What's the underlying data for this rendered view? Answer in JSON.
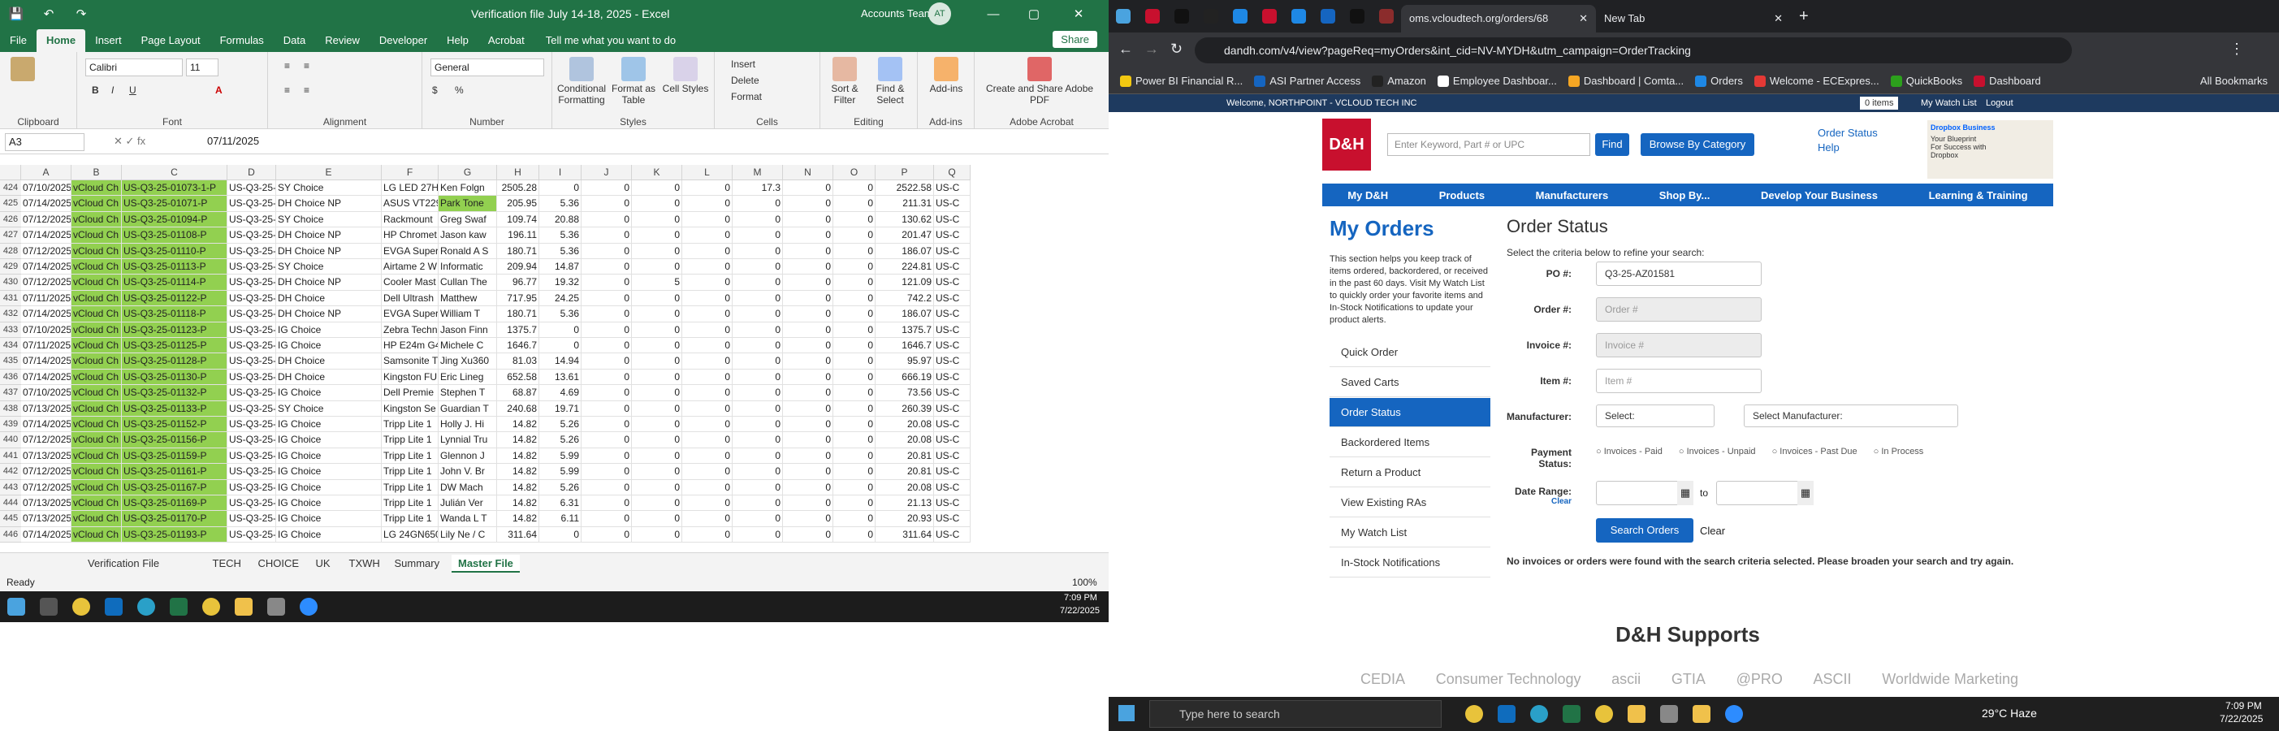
{
  "excel": {
    "title": "Verification file July 14-18, 2025 - Excel",
    "user": "Accounts Team",
    "avatar": "AT",
    "tabs": [
      "File",
      "Home",
      "Insert",
      "Page Layout",
      "Formulas",
      "Data",
      "Review",
      "Developer",
      "Help",
      "Acrobat"
    ],
    "tell": "Tell me what you want to do",
    "share": "Share",
    "font": "Calibri",
    "font_size": "11",
    "number_format": "General",
    "groups": [
      "Clipboard",
      "Font",
      "Alignment",
      "Number",
      "Styles",
      "Cells",
      "Editing",
      "Add-ins",
      "Adobe Acrobat"
    ],
    "buttons": {
      "conditional": "Conditional Formatting",
      "format_table": "Format as Table",
      "cell_styles": "Cell Styles",
      "insert": "Insert",
      "delete": "Delete",
      "format": "Format",
      "sort": "Sort & Filter",
      "find": "Find & Select",
      "addins": "Add-ins",
      "pdf": "Create and Share Adobe PDF"
    },
    "name_box": "A3",
    "formula_value": "07/11/2025",
    "columns": [
      "A",
      "B",
      "C",
      "D",
      "E",
      "F",
      "G",
      "H",
      "I",
      "J",
      "K",
      "L",
      "M",
      "N",
      "O",
      "P",
      "Q"
    ],
    "rows": [
      [
        "424",
        "07/10/2025",
        "vCloud Ch",
        "US-Q3-25-01073-1-P",
        "US-Q3-25-",
        "SY Choice",
        "LG LED 27HJ",
        "Ken Folgn",
        "2505.28",
        "0",
        "0",
        "0",
        "0",
        "17.3",
        "0",
        "0",
        "2522.58",
        "US-C"
      ],
      [
        "425",
        "07/14/2025",
        "vCloud Ch",
        "US-Q3-25-01071-P",
        "US-Q3-25-",
        "DH Choice NP",
        "ASUS VT229",
        "Park Tone",
        "205.95",
        "5.36",
        "0",
        "0",
        "0",
        "0",
        "0",
        "0",
        "211.31",
        "US-C"
      ],
      [
        "426",
        "07/12/2025",
        "vCloud Ch",
        "US-Q3-25-01094-P",
        "US-Q3-25-",
        "SY Choice",
        "Rackmount",
        "Greg Swaf",
        "109.74",
        "20.88",
        "0",
        "0",
        "0",
        "0",
        "0",
        "0",
        "130.62",
        "US-C"
      ],
      [
        "427",
        "07/14/2025",
        "vCloud Ch",
        "US-Q3-25-01108-P",
        "US-Q3-25-",
        "DH Choice NP",
        "HP Chromet",
        "Jason kaw",
        "196.11",
        "5.36",
        "0",
        "0",
        "0",
        "0",
        "0",
        "0",
        "201.47",
        "US-C"
      ],
      [
        "428",
        "07/12/2025",
        "vCloud Ch",
        "US-Q3-25-01110-P",
        "US-Q3-25-",
        "DH Choice NP",
        "EVGA Super",
        "Ronald A S",
        "180.71",
        "5.36",
        "0",
        "0",
        "0",
        "0",
        "0",
        "0",
        "186.07",
        "US-C"
      ],
      [
        "429",
        "07/14/2025",
        "vCloud Ch",
        "US-Q3-25-01113-P",
        "US-Q3-25-",
        "SY Choice",
        "Airtame 2 W",
        "Informatic",
        "209.94",
        "14.87",
        "0",
        "0",
        "0",
        "0",
        "0",
        "0",
        "224.81",
        "US-C"
      ],
      [
        "430",
        "07/12/2025",
        "vCloud Ch",
        "US-Q3-25-01114-P",
        "US-Q3-25-",
        "DH Choice NP",
        "Cooler Mast",
        "Cullan The",
        "96.77",
        "19.32",
        "0",
        "5",
        "0",
        "0",
        "0",
        "0",
        "121.09",
        "US-C"
      ],
      [
        "431",
        "07/11/2025",
        "vCloud Ch",
        "US-Q3-25-01122-P",
        "US-Q3-25-",
        "DH Choice",
        "Dell Ultrash",
        "Matthew",
        "717.95",
        "24.25",
        "0",
        "0",
        "0",
        "0",
        "0",
        "0",
        "742.2",
        "US-C"
      ],
      [
        "432",
        "07/14/2025",
        "vCloud Ch",
        "US-Q3-25-01118-P",
        "US-Q3-25-",
        "DH Choice NP",
        "EVGA Super",
        "William T",
        "180.71",
        "5.36",
        "0",
        "0",
        "0",
        "0",
        "0",
        "0",
        "186.07",
        "US-C"
      ],
      [
        "433",
        "07/10/2025",
        "vCloud Ch",
        "US-Q3-25-01123-P",
        "US-Q3-25-",
        "IG Choice",
        "Zebra Techn",
        "Jason Finn",
        "1375.7",
        "0",
        "0",
        "0",
        "0",
        "0",
        "0",
        "0",
        "1375.7",
        "US-C"
      ],
      [
        "434",
        "07/11/2025",
        "vCloud Ch",
        "US-Q3-25-01125-P",
        "US-Q3-25-",
        "IG Choice",
        "HP E24m G4",
        "Michele C",
        "1646.7",
        "0",
        "0",
        "0",
        "0",
        "0",
        "0",
        "0",
        "1646.7",
        "US-C"
      ],
      [
        "435",
        "07/14/2025",
        "vCloud Ch",
        "US-Q3-25-01128-P",
        "US-Q3-25-",
        "DH Choice",
        "Samsonite T",
        "Jing Xu360",
        "81.03",
        "14.94",
        "0",
        "0",
        "0",
        "0",
        "0",
        "0",
        "95.97",
        "US-C"
      ],
      [
        "436",
        "07/14/2025",
        "vCloud Ch",
        "US-Q3-25-01130-P",
        "US-Q3-25-",
        "DH Choice",
        "Kingston FU",
        "Eric Lineg",
        "652.58",
        "13.61",
        "0",
        "0",
        "0",
        "0",
        "0",
        "0",
        "666.19",
        "US-C"
      ],
      [
        "437",
        "07/10/2025",
        "vCloud Ch",
        "US-Q3-25-01132-P",
        "US-Q3-25-",
        "IG Choice",
        "Dell Premie",
        "Stephen T",
        "68.87",
        "4.69",
        "0",
        "0",
        "0",
        "0",
        "0",
        "0",
        "73.56",
        "US-C"
      ],
      [
        "438",
        "07/13/2025",
        "vCloud Ch",
        "US-Q3-25-01133-P",
        "US-Q3-25-",
        "SY Choice",
        "Kingston Se",
        "Guardian T",
        "240.68",
        "19.71",
        "0",
        "0",
        "0",
        "0",
        "0",
        "0",
        "260.39",
        "US-C"
      ],
      [
        "439",
        "07/14/2025",
        "vCloud Ch",
        "US-Q3-25-01152-P",
        "US-Q3-25-",
        "IG Choice",
        "Tripp Lite 1",
        "Holly J. Hi",
        "14.82",
        "5.26",
        "0",
        "0",
        "0",
        "0",
        "0",
        "0",
        "20.08",
        "US-C"
      ],
      [
        "440",
        "07/12/2025",
        "vCloud Ch",
        "US-Q3-25-01156-P",
        "US-Q3-25-",
        "IG Choice",
        "Tripp Lite 1",
        "Lynnial Tru",
        "14.82",
        "5.26",
        "0",
        "0",
        "0",
        "0",
        "0",
        "0",
        "20.08",
        "US-C"
      ],
      [
        "441",
        "07/13/2025",
        "vCloud Ch",
        "US-Q3-25-01159-P",
        "US-Q3-25-",
        "IG Choice",
        "Tripp Lite 1",
        "Glennon J",
        "14.82",
        "5.99",
        "0",
        "0",
        "0",
        "0",
        "0",
        "0",
        "20.81",
        "US-C"
      ],
      [
        "442",
        "07/12/2025",
        "vCloud Ch",
        "US-Q3-25-01161-P",
        "US-Q3-25-",
        "IG Choice",
        "Tripp Lite 1",
        "John V. Br",
        "14.82",
        "5.99",
        "0",
        "0",
        "0",
        "0",
        "0",
        "0",
        "20.81",
        "US-C"
      ],
      [
        "443",
        "07/12/2025",
        "vCloud Ch",
        "US-Q3-25-01167-P",
        "US-Q3-25-",
        "IG Choice",
        "Tripp Lite 1",
        "DW Mach",
        "14.82",
        "5.26",
        "0",
        "0",
        "0",
        "0",
        "0",
        "0",
        "20.08",
        "US-C"
      ],
      [
        "444",
        "07/13/2025",
        "vCloud Ch",
        "US-Q3-25-01169-P",
        "US-Q3-25-",
        "IG Choice",
        "Tripp Lite 1",
        "Julián Ver",
        "14.82",
        "6.31",
        "0",
        "0",
        "0",
        "0",
        "0",
        "0",
        "21.13",
        "US-C"
      ],
      [
        "445",
        "07/13/2025",
        "vCloud Ch",
        "US-Q3-25-01170-P",
        "US-Q3-25-",
        "IG Choice",
        "Tripp Lite 1",
        "Wanda L T",
        "14.82",
        "6.11",
        "0",
        "0",
        "0",
        "0",
        "0",
        "0",
        "20.93",
        "US-C"
      ],
      [
        "446",
        "07/14/2025",
        "vCloud Ch",
        "US-Q3-25-01193-P",
        "US-Q3-25-",
        "IG Choice",
        "LG 24GN650",
        "Lily Ne / C",
        "311.64",
        "0",
        "0",
        "0",
        "0",
        "0",
        "0",
        "0",
        "311.64",
        "US-C"
      ]
    ],
    "sheet_tabs": [
      "Verification File",
      "TECH",
      "CHOICE",
      "UK",
      "TXWH",
      "Summary",
      "Master File"
    ],
    "status": "Ready",
    "zoom": "100%",
    "time": "7:09 PM",
    "date": "7/22/2025"
  },
  "browser": {
    "tab1": "oms.vcloudtech.org/orders/68",
    "tab2": "New Tab",
    "url": "dandh.com/v4/view?pageReq=myOrders&int_cid=NV-MYDH&utm_campaign=OrderTracking",
    "bookmarks": [
      "Power BI Financial R...",
      "ASI Partner Access",
      "Amazon",
      "Employee Dashboar...",
      "Dashboard | Comta...",
      "Orders",
      "Welcome - ECExpres...",
      "QuickBooks",
      "Dashboard"
    ],
    "all_bookmarks": "All Bookmarks",
    "welcome": "Welcome, NORTHPOINT - VCLOUD TECH INC",
    "cart": "0 items",
    "watch": "My Watch List",
    "logout": "Logout",
    "logo": "D&H",
    "search_ph": "Enter Keyword, Part # or UPC",
    "find": "Find",
    "browse": "Browse By Category",
    "order_status_link": "Order Status",
    "help": "Help",
    "promo_brand": "Dropbox Business",
    "promo_text": "Your Blueprint For Success with Dropbox",
    "nav": [
      "My D&H",
      "Products",
      "Manufacturers",
      "Shop By...",
      "Develop Your Business",
      "Learning & Training"
    ],
    "my_orders": "My Orders",
    "my_orders_desc": "This section helps you keep track of items ordered, backordered, or received in the past 60 days. Visit My Watch List to quickly order your favorite items and In-Stock Notifications to update your product alerts.",
    "side": [
      "Quick Order",
      "Saved Carts",
      "Order Status",
      "Backordered Items",
      "Return a Product",
      "View Existing RAs",
      "My Watch List",
      "In-Stock Notifications"
    ],
    "order_status": "Order Status",
    "criteria": "Select the criteria below to refine your search:",
    "po_label": "PO #:",
    "po_value": "Q3-25-AZ01581",
    "order_label": "Order #:",
    "order_ph": "Order #",
    "invoice_label": "Invoice #:",
    "invoice_ph": "Invoice #",
    "item_label": "Item #:",
    "item_ph": "Item #",
    "mfr_label": "Manufacturer:",
    "mfr_select": "Select:",
    "mfr_select2": "Select Manufacturer:",
    "pay_label": "Payment Status:",
    "pay_opts": [
      "Invoices - Paid",
      "Invoices - Unpaid",
      "Invoices - Past Due",
      "In Process"
    ],
    "date_label": "Date Range:",
    "clear_link": "Clear",
    "to": "to",
    "search_btn": "Search Orders",
    "clear_btn": "Clear",
    "no_results": "No invoices or orders were found with the search criteria selected. Please broaden your search and try again.",
    "supports": "D&H Supports",
    "support_logos": [
      "CEDIA",
      "Consumer Technology",
      "ascii",
      "GTIA",
      "@PRO",
      "ASCII",
      "Worldwide Marketing"
    ]
  },
  "win": {
    "search": "Type here to search",
    "weather": "29°C Haze",
    "time": "7:09 PM",
    "date": "7/22/2025"
  }
}
